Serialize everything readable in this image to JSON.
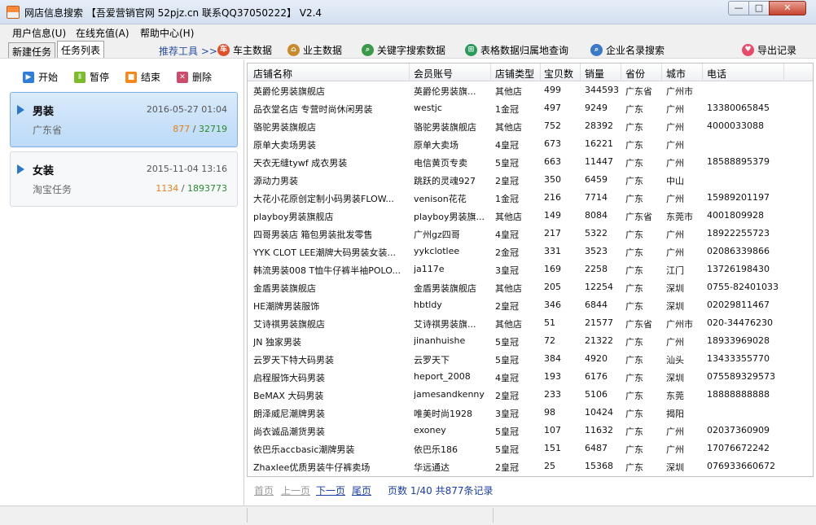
{
  "window": {
    "title": "网店信息搜索  【吾爱营销官网 52pjz.cn 联系QQ37050222】 V2.4",
    "min_glyph": "—",
    "max_glyph": "□",
    "close_glyph": "✕"
  },
  "menu": [
    "用户信息(U)",
    "在线充值(A)",
    "帮助中心(H)"
  ],
  "tabs": [
    "新建任务",
    "任务列表"
  ],
  "toolbar": {
    "recommend_label": "推荐工具 >>",
    "tools": [
      {
        "label": "车主数据",
        "icon": "car-icon",
        "color": "#e0502a",
        "glyph": "车"
      },
      {
        "label": "业主数据",
        "icon": "house-icon",
        "color": "#c88a2a",
        "glyph": "⌂"
      },
      {
        "label": "关键字搜索数据",
        "icon": "search-icon",
        "color": "#3a9a4a",
        "glyph": "⌕"
      },
      {
        "label": "表格数据归属地查询",
        "icon": "table-icon",
        "color": "#2a9a5a",
        "glyph": "⊞"
      },
      {
        "label": "企业名录搜索",
        "icon": "company-search-icon",
        "color": "#3a7ac8",
        "glyph": "⌕"
      }
    ],
    "export_label": "导出记录"
  },
  "actions": [
    {
      "label": "开始",
      "icon": "play-icon",
      "color": "#2f7fd8",
      "glyph": "▶"
    },
    {
      "label": "暂停",
      "icon": "pause-icon",
      "color": "#7cbc2a",
      "glyph": "Ⅱ"
    },
    {
      "label": "结束",
      "icon": "stop-icon",
      "color": "#f08a1c",
      "glyph": "■"
    },
    {
      "label": "删除",
      "icon": "delete-icon",
      "color": "#d04a6a",
      "glyph": "✕"
    }
  ],
  "tasks": [
    {
      "name": "男装",
      "date": "2016-05-27 01:04",
      "sub": "广东省",
      "count_a": "877",
      "sep": "/",
      "count_b": "32719"
    },
    {
      "name": "女装",
      "date": "2015-11-04 13:16",
      "sub": "淘宝任务",
      "count_a": "1134",
      "sep": "/",
      "count_b": "1893773"
    }
  ],
  "table": {
    "columns": [
      "店铺名称",
      "会员账号",
      "店铺类型",
      "宝贝数",
      "销量",
      "省份",
      "城市",
      "电话"
    ],
    "rows": [
      [
        "英爵伦男装旗舰店",
        "英爵伦男装旗...",
        "其他店",
        "499",
        "344593",
        "广东省",
        "广州市",
        ""
      ],
      [
        "品衣堂名店 专营时尚休闲男装",
        "westjc",
        "1金冠",
        "497",
        "9249",
        "广东",
        "广州",
        "13380065845"
      ],
      [
        "骆驼男装旗舰店",
        "骆驼男装旗舰店",
        "其他店",
        "752",
        "28392",
        "广东",
        "广州",
        "4000033088"
      ],
      [
        "原单大卖场男装",
        "原单大卖场",
        "4皇冠",
        "673",
        "16221",
        "广东",
        "广州",
        ""
      ],
      [
        "天衣无缝tywf 成衣男装",
        "电信黄页专卖",
        "5皇冠",
        "663",
        "11447",
        "广东",
        "广州",
        "18588895379"
      ],
      [
        "源动力男装",
        "跳跃的灵魂927",
        "2皇冠",
        "350",
        "6459",
        "广东",
        "中山",
        ""
      ],
      [
        "大花小花原创定制小码男装FLOW...",
        "venison花花",
        "1金冠",
        "216",
        "7714",
        "广东",
        "广州",
        "15989201197"
      ],
      [
        "playboy男装旗舰店",
        "playboy男装旗...",
        "其他店",
        "149",
        "8084",
        "广东省",
        "东莞市",
        "4001809928"
      ],
      [
        "四哥男装店 箱包男装批发零售",
        "广州gz四哥",
        "4皇冠",
        "217",
        "5322",
        "广东",
        "广州",
        "18922255723"
      ],
      [
        "YYK CLOT LEE潮牌大码男装女装...",
        "yykclotlee",
        "2金冠",
        "331",
        "3523",
        "广东",
        "广州",
        "02086339866"
      ],
      [
        "韩流男装008 T恤牛仔裤半袖POLO...",
        "ja117e",
        "3皇冠",
        "169",
        "2258",
        "广东",
        "江门",
        "13726198430"
      ],
      [
        "金盾男装旗舰店",
        "金盾男装旗舰店",
        "其他店",
        "205",
        "12254",
        "广东",
        "深圳",
        "0755-82401033"
      ],
      [
        "HE潮牌男装服饰",
        "hbtldy",
        "2皇冠",
        "346",
        "6844",
        "广东",
        "深圳",
        "02029811467"
      ],
      [
        "艾诗祺男装旗舰店",
        "艾诗祺男装旗...",
        "其他店",
        "51",
        "21577",
        "广东省",
        "广州市",
        "020-34476230"
      ],
      [
        "JN 独家男装",
        "jinanhuishe",
        "5皇冠",
        "72",
        "21322",
        "广东",
        "广州",
        "18933969028"
      ],
      [
        "云罗天下特大码男装",
        "云罗天下",
        "5皇冠",
        "384",
        "4920",
        "广东",
        "汕头",
        "13433355770"
      ],
      [
        "启程服饰大码男装",
        "heport_2008",
        "4皇冠",
        "193",
        "6176",
        "广东",
        "深圳",
        "075589329573"
      ],
      [
        "BeMAX 大码男装",
        "jamesandkenny",
        "2皇冠",
        "233",
        "5106",
        "广东",
        "东莞",
        "18888888888"
      ],
      [
        "朗泽威尼潮牌男装",
        "唯美时尚1928",
        "3皇冠",
        "98",
        "10424",
        "广东",
        "揭阳",
        ""
      ],
      [
        "尚衣诚品潮货男装",
        "exoney",
        "5皇冠",
        "107",
        "11632",
        "广东",
        "广州",
        "02037360909"
      ],
      [
        "依巴乐accbasic潮牌男装",
        "依巴乐186",
        "5皇冠",
        "151",
        "6487",
        "广东",
        "广州",
        "17076672242"
      ],
      [
        "Zhaxlee优质男装牛仔裤卖场",
        "华远通达",
        "2皇冠",
        "25",
        "15368",
        "广东",
        "深圳",
        "076933660672"
      ]
    ]
  },
  "pager": {
    "first": "首页",
    "prev": "上一页",
    "next": "下一页",
    "last": "尾页",
    "info": "页数 1/40 共877条记录"
  }
}
